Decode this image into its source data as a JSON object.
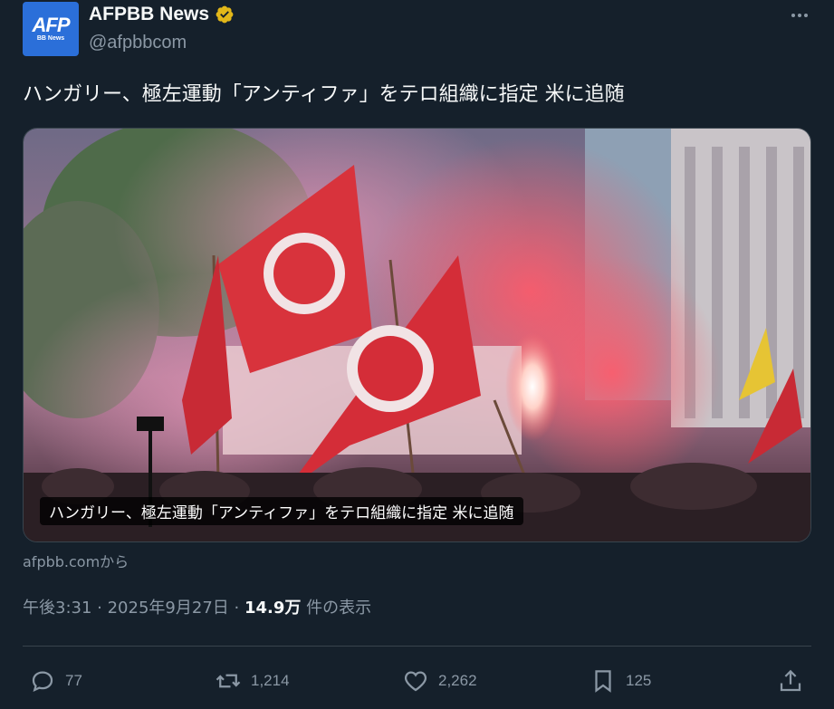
{
  "author": {
    "avatar_text": "AFP",
    "avatar_subtext": "BB News",
    "display_name": "AFPBB News",
    "handle": "@afpbbcom",
    "verified_color": "#e2b719"
  },
  "tweet": {
    "text": "ハンガリー、極左運動「アンティファ」をテロ組織に指定 米に追随",
    "media_caption": "ハンガリー、極左運動「アンティファ」をテロ組織に指定 米に追随",
    "source": "afpbb.comから",
    "time": "午後3:31",
    "date": "2025年9月27日",
    "views_count": "14.9万",
    "views_label": "件の表示"
  },
  "actions": {
    "replies": "77",
    "reposts": "1,214",
    "likes": "2,262",
    "bookmarks": "125"
  },
  "icons": {
    "more": "more-icon",
    "reply": "reply-icon",
    "repost": "repost-icon",
    "like": "heart-icon",
    "bookmark": "bookmark-icon",
    "share": "share-icon"
  },
  "colors": {
    "background": "#15202b",
    "text_primary": "#f7f9f9",
    "text_secondary": "#8b98a5",
    "border": "#38444d"
  }
}
